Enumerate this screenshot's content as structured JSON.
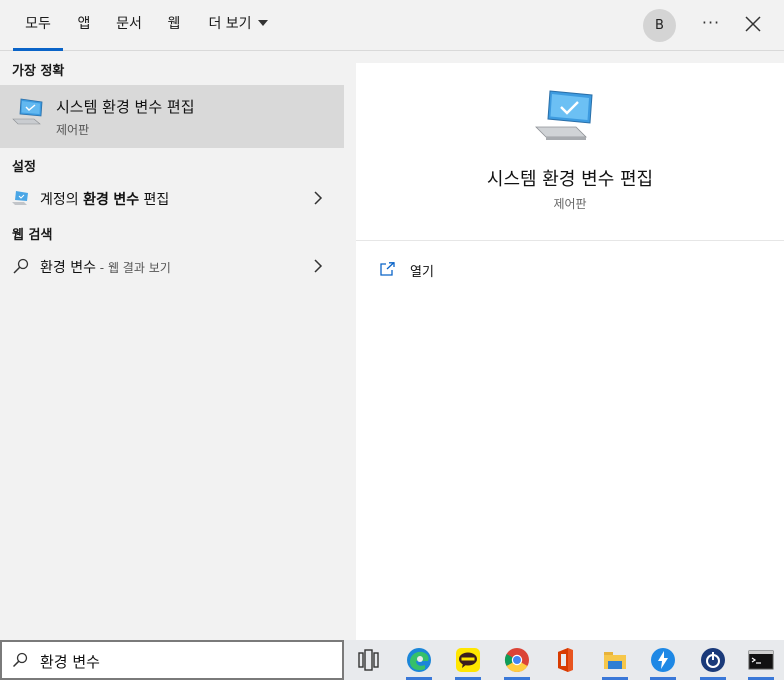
{
  "tabs": [
    {
      "label": "모두"
    },
    {
      "label": "앱"
    },
    {
      "label": "문서"
    },
    {
      "label": "웹"
    },
    {
      "label": "더 보기"
    }
  ],
  "account": {
    "initial": "B"
  },
  "menu_label": "···",
  "sections": {
    "best_match": "가장 정확",
    "settings": "설정",
    "web_search": "웹 검색"
  },
  "best_match": {
    "title": "시스템 환경 변수 편집",
    "subtitle": "제어판"
  },
  "settings_item": {
    "prefix": "계정의 ",
    "bold1": "환경",
    "space": " ",
    "bold2": "변수",
    "suffix": " 편집"
  },
  "web_item": {
    "query": "환경 변수",
    "suffix": " - 웹 결과 보기"
  },
  "detail": {
    "title": "시스템 환경 변수 편집",
    "subtitle": "제어판",
    "open_label": "열기"
  },
  "search": {
    "value": "환경 변수"
  },
  "taskbar_icons": [
    "task-view-icon",
    "edge-icon",
    "kakaotalk-icon",
    "chrome-icon",
    "office-icon",
    "file-explorer-icon",
    "app-bolt-icon",
    "app-power-icon",
    "terminal-icon"
  ],
  "colors": {
    "accent": "#0a64c8",
    "selected_bg": "#d9d9d9",
    "panel_bg": "#f2f2f2"
  }
}
